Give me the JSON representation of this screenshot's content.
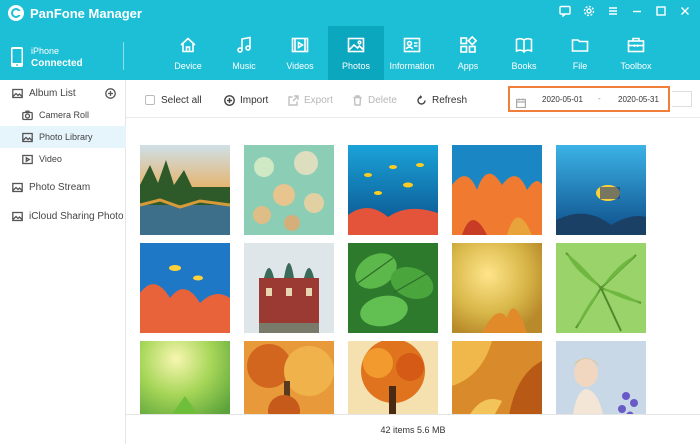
{
  "app": {
    "title": "PanFone Manager"
  },
  "device": {
    "name": "iPhone",
    "status": "Connected"
  },
  "nav": {
    "items": [
      {
        "label": "Device",
        "icon": "home-icon"
      },
      {
        "label": "Music",
        "icon": "music-icon"
      },
      {
        "label": "Videos",
        "icon": "video-icon"
      },
      {
        "label": "Photos",
        "icon": "photo-icon",
        "active": true
      },
      {
        "label": "Information",
        "icon": "contact-card-icon"
      },
      {
        "label": "Apps",
        "icon": "apps-icon"
      },
      {
        "label": "Books",
        "icon": "book-icon"
      },
      {
        "label": "File",
        "icon": "folder-icon"
      },
      {
        "label": "Toolbox",
        "icon": "toolbox-icon"
      }
    ]
  },
  "sidebar": {
    "album_list": "Album List",
    "items": [
      {
        "label": "Camera Roll",
        "icon": "camera-icon"
      },
      {
        "label": "Photo Library",
        "icon": "image-icon",
        "selected": true
      },
      {
        "label": "Video",
        "icon": "play-icon"
      }
    ],
    "photo_stream": "Photo Stream",
    "icloud": "iCloud Sharing Photo"
  },
  "toolbar": {
    "select_all": "Select all",
    "import": "Import",
    "export": "Export",
    "delete": "Delete",
    "refresh": "Refresh"
  },
  "date_filter": {
    "start": "2020-05-01",
    "separator": "-",
    "end": "2020-05-31"
  },
  "status": {
    "summary": "42 items 5.6 MB"
  },
  "colors": {
    "header": "#1dbfd6",
    "nav_active": "#0aa7bf",
    "highlight": "#ef7f3a",
    "selected_row": "#e6f4fb"
  }
}
